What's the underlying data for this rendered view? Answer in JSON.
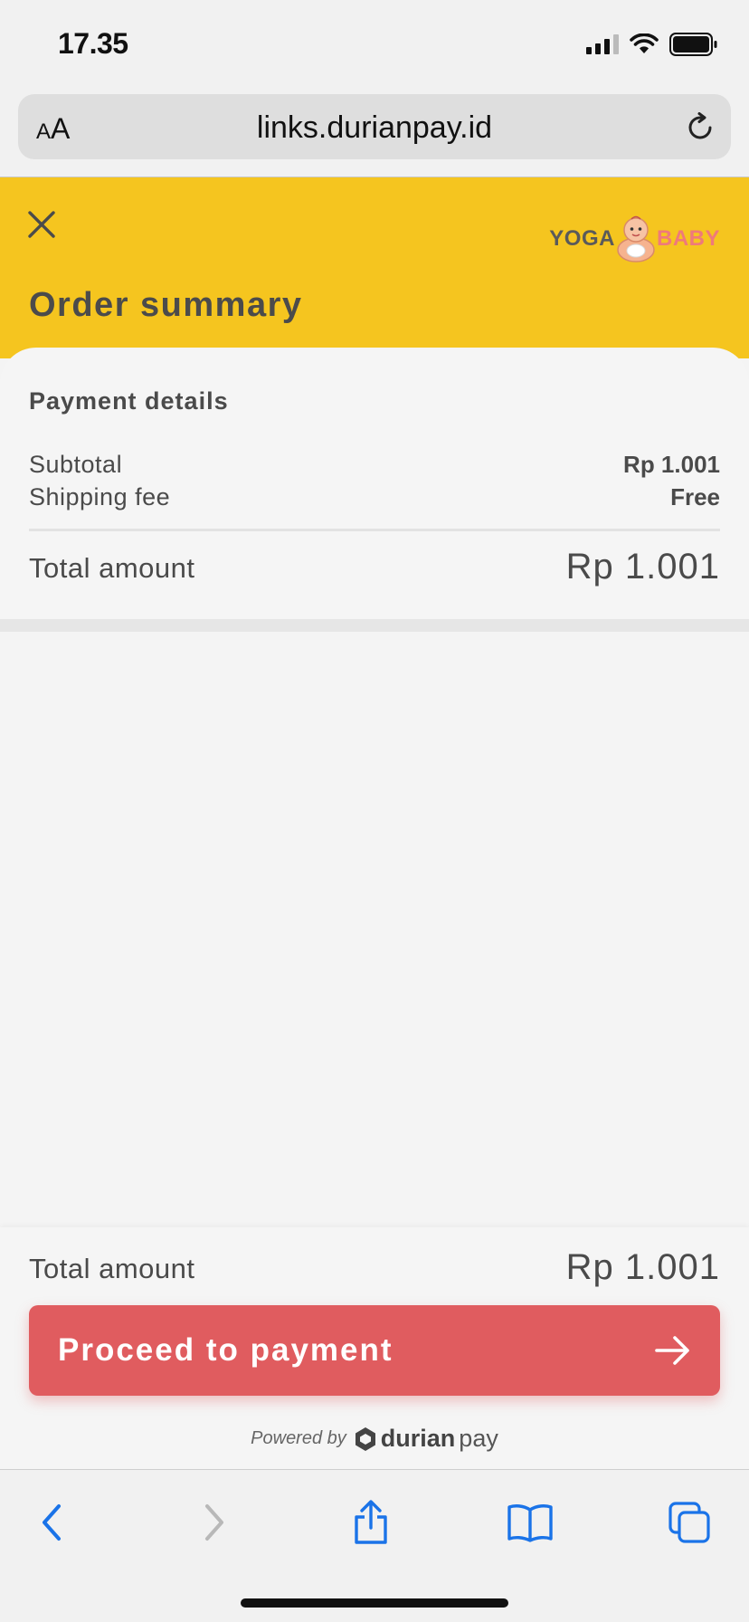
{
  "status_bar": {
    "time": "17.35"
  },
  "browser": {
    "text_size_label_small": "A",
    "text_size_label_large": "A",
    "url": "links.durianpay.id"
  },
  "header": {
    "title": "Order summary",
    "logo_left": "YOGA",
    "logo_right": "BABY"
  },
  "payment_details": {
    "title": "Payment details",
    "rows": [
      {
        "label": "Subtotal",
        "value": "Rp 1.001"
      },
      {
        "label": "Shipping fee",
        "value": "Free"
      }
    ],
    "total_label": "Total amount",
    "total_value": "Rp 1.001"
  },
  "footer": {
    "total_label": "Total amount",
    "total_value": "Rp 1.001",
    "button_label": "Proceed to payment",
    "powered_by": "Powered by",
    "brand_part1": "durian",
    "brand_part2": "pay"
  },
  "colors": {
    "header_bg": "#f5c51f",
    "button_bg": "#e05c5f",
    "ios_blue": "#1a73e8"
  },
  "icons": {
    "close": "close-icon",
    "reload": "reload-icon",
    "arrow": "arrow-right-icon",
    "back": "chevron-left-icon",
    "forward": "chevron-right-icon",
    "share": "share-icon",
    "bookmarks": "book-icon",
    "tabs": "tabs-icon"
  }
}
